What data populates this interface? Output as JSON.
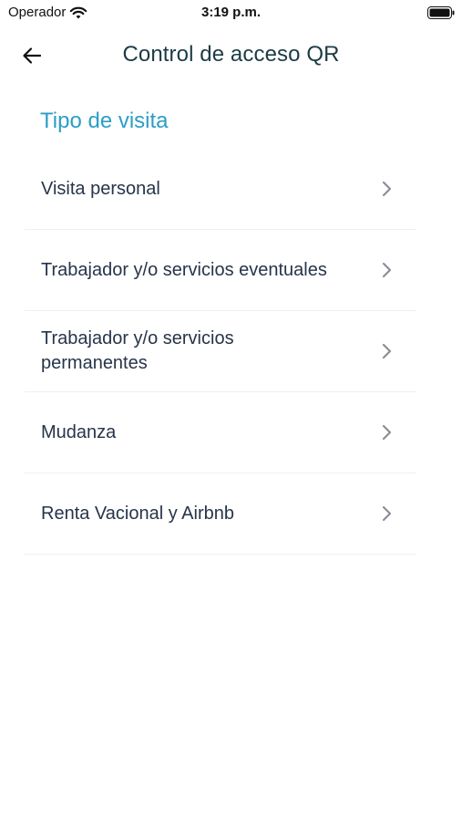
{
  "status_bar": {
    "carrier": "Operador",
    "time": "3:19 p.m."
  },
  "header": {
    "title": "Control de acceso QR",
    "back_icon": "arrow-left-icon"
  },
  "section": {
    "title": "Tipo de visita"
  },
  "items": [
    {
      "label": "Visita personal"
    },
    {
      "label": "Trabajador y/o servicios eventuales"
    },
    {
      "label": "Trabajador y/o servicios permanentes"
    },
    {
      "label": "Mudanza"
    },
    {
      "label": "Renta Vacional y Airbnb"
    }
  ],
  "colors": {
    "accent": "#2b9ec6",
    "title": "#1d3b45",
    "text": "#27344a",
    "chevron": "#8a8f98"
  }
}
